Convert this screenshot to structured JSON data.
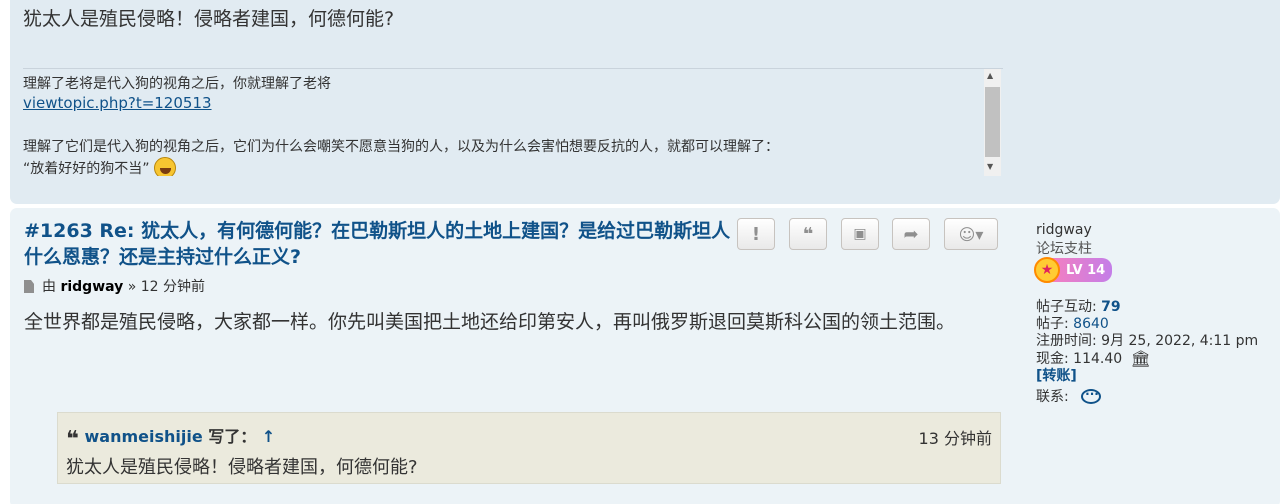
{
  "prev_post": {
    "quote_text": "犹太人是殖民侵略！侵略者建国，何德何能?",
    "signature": {
      "line1": "理解了老将是代入狗的视角之后，你就理解了老将",
      "link": "viewtopic.php?t=120513",
      "line2": "理解了它们是代入狗的视角之后，它们为什么会嘲笑不愿意当狗的人，以及为什么会害怕想要反抗的人，就都可以理解了：",
      "line3": "“放着好好的狗不当”"
    }
  },
  "post": {
    "title": "#1263 Re: 犹太人，有何德何能？在巴勒斯坦人的土地上建国？是给过巴勒斯坦人什么恩惠？还是主持过什么正义?",
    "meta_by": "由",
    "author": "ridgway",
    "meta_time": "» 12 分钟前",
    "body": "全世界都是殖民侵略，大家都一样。你先叫美国把土地还给印第安人，再叫俄罗斯退回莫斯科公国的领土范围。",
    "actions": [
      {
        "icon": "exclamation-icon",
        "glyph": "!"
      },
      {
        "icon": "quote-icon",
        "glyph": "❝"
      },
      {
        "icon": "gift-icon",
        "glyph": "▣"
      },
      {
        "icon": "share-icon",
        "glyph": "➦"
      },
      {
        "icon": "emoji-dropdown-icon",
        "glyph": "☺▾"
      }
    ],
    "quote": {
      "author": "wanmeishijie",
      "wrote": "写了：",
      "arrow": "↑",
      "time": "13 分钟前",
      "text": "犹太人是殖民侵略！侵略者建国，何德何能?"
    }
  },
  "profile": {
    "username": "ridgway",
    "rank": "论坛支柱",
    "level": "LV 14",
    "interactions_label": "帖子互动:",
    "interactions_value": "79",
    "posts_label": "帖子:",
    "posts_value": "8640",
    "joined_label": "注册时间:",
    "joined_value": "9月 25, 2022, 4:11 pm",
    "cash_label": "现金:",
    "cash_value": "114.40",
    "transfer": "[转账]",
    "contact_label": "联系:"
  },
  "colors": {
    "link": "#105289",
    "post_bg": "#ecf3f7",
    "prev_post_bg": "#e1ebf2",
    "quote_bg": "#ebeadd"
  }
}
